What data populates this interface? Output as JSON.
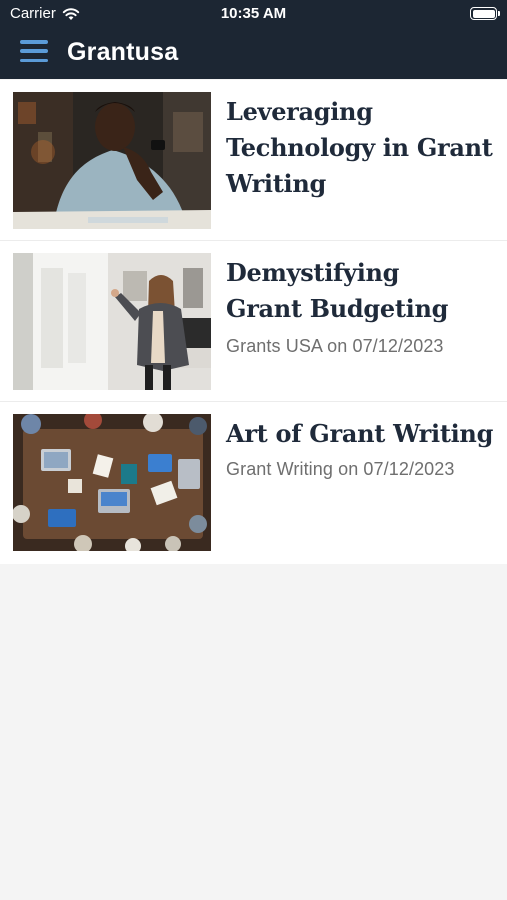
{
  "status_bar": {
    "carrier": "Carrier",
    "time": "10:35 AM"
  },
  "header": {
    "title": "Grantusa",
    "menu_icon": "hamburger-menu-icon"
  },
  "colors": {
    "header_bg": "#1c2633",
    "menu_icon": "#5b9bd8",
    "title_text": "#1f2a3a",
    "meta_text": "#6f6f6f"
  },
  "posts": [
    {
      "title_lines": [
        "Leveraging",
        "Technology in Grant",
        "Writing"
      ],
      "meta": "",
      "image": "man-thinking-at-laptop-photo"
    },
    {
      "title_lines": [
        "Demystifying",
        "Grant Budgeting"
      ],
      "meta": "Grants USA on 07/12/2023",
      "image": "woman-presenting-at-whiteboard-photo"
    },
    {
      "title_lines": [
        "Art of Grant Writing"
      ],
      "meta": "Grant Writing on 07/12/2023",
      "image": "team-meeting-overhead-photo"
    }
  ]
}
